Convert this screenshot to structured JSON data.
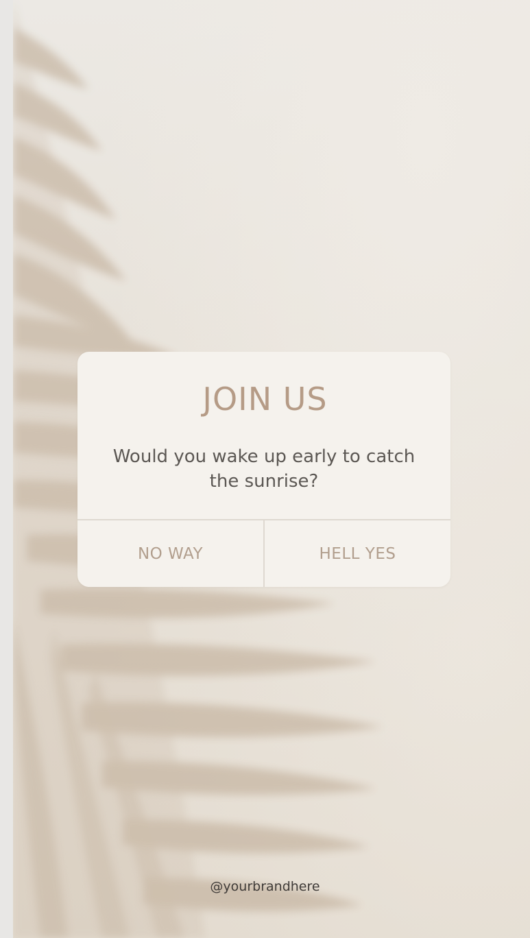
{
  "popup": {
    "title": "JOIN US",
    "message": "Would you wake up early to catch the sunrise?",
    "buttons": {
      "no_label": "NO WAY",
      "yes_label": "HELL YES"
    }
  },
  "footer": {
    "brand": "@yourbrandhere"
  },
  "colors": {
    "title": "#b59b86",
    "message": "#5b5753",
    "button_text": "#b19e8d",
    "card": "#f5f2ed",
    "background": "#e7e1d8",
    "shadow": "#c5b6a3"
  }
}
